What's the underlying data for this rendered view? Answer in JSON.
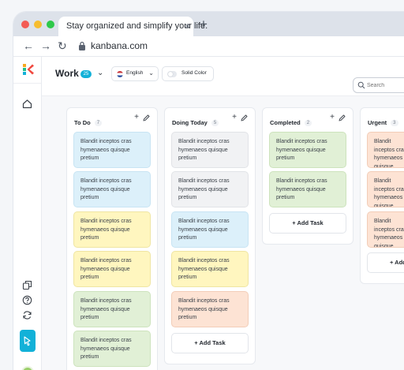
{
  "browser": {
    "tab_title": "Stay organized and simplify your life.",
    "tab_close": "×",
    "new_tab": "+",
    "url": "kanbana.com",
    "back": "←",
    "forward": "→",
    "reload": "↻"
  },
  "header": {
    "board_name": "Work",
    "board_count": "25",
    "board_chevron": "⌄",
    "language": "English",
    "language_chevron": "⌄",
    "color_mode": "Solid Color",
    "search_placeholder": "Search"
  },
  "columns": [
    {
      "title": "To Do",
      "count": "7",
      "cards": [
        {
          "text": "Blandit inceptos cras hymenaeos quisque pretium",
          "color": "blue"
        },
        {
          "text": "Blandit inceptos cras hymenaeos quisque pretium",
          "color": "blue"
        },
        {
          "text": "Blandit inceptos cras hymenaeos quisque pretium",
          "color": "yellow"
        },
        {
          "text": "Blandit inceptos cras hymenaeos quisque pretium",
          "color": "yellow"
        },
        {
          "text": "Blandit inceptos cras hymenaeos quisque pretium",
          "color": "green"
        },
        {
          "text": "Blandit inceptos cras hymenaeos quisque pretium",
          "color": "green"
        }
      ]
    },
    {
      "title": "Doing Today",
      "count": "5",
      "cards": [
        {
          "text": "Blandit inceptos cras hymenaeos quisque pretium",
          "color": "gray"
        },
        {
          "text": "Blandit inceptos cras hymenaeos quisque pretium",
          "color": "gray"
        },
        {
          "text": "Blandit inceptos cras hymenaeos quisque pretium",
          "color": "blue"
        },
        {
          "text": "Blandit inceptos cras hymenaeos quisque pretium",
          "color": "yellow"
        },
        {
          "text": "Blandit inceptos cras hymenaeos quisque pretium",
          "color": "peach"
        }
      ],
      "add_task": "+ Add Task"
    },
    {
      "title": "Completed",
      "count": "2",
      "cards": [
        {
          "text": "Blandit inceptos cras hymenaeos quisque pretium",
          "color": "green"
        },
        {
          "text": "Blandit inceptos cras hymenaeos quisque pretium",
          "color": "green"
        }
      ],
      "add_task": "+ Add Task"
    },
    {
      "title": "Urgent",
      "count": "3",
      "cards": [
        {
          "text": "Blandit inceptos cras hymenaeos quisque pretium",
          "color": "peach"
        },
        {
          "text": "Blandit inceptos cras hymenaeos quisque pretium",
          "color": "peach"
        },
        {
          "text": "Blandit inceptos cras hymenaeos quisque pretium",
          "color": "peach"
        }
      ],
      "add_task": "+ Add Task"
    }
  ],
  "column_icons": {
    "add": "+",
    "edit": "pencil-icon"
  },
  "colors": {
    "accent": "#12b1d8",
    "blue": "#dcf0fa",
    "yellow": "#fff6bf",
    "green": "#e1f0d6",
    "gray": "#f1f2f4",
    "peach": "#fde3d4"
  },
  "sidebar": {
    "icons": [
      "kanbana-logo",
      "home-icon",
      "copy-icon",
      "help-icon",
      "sync-icon",
      "pointer-icon",
      "avatar"
    ]
  }
}
